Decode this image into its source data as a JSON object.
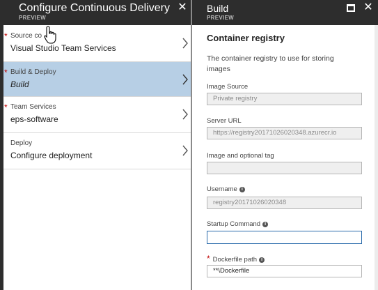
{
  "left_blade": {
    "title": "Configure Continuous Delivery",
    "subtitle": "PREVIEW",
    "close_glyph": "✕",
    "steps": [
      {
        "label": "Source co",
        "value": "Visual Studio Team Services",
        "required": "*"
      },
      {
        "label": "Build & Deploy",
        "value": "Build",
        "required": "*",
        "selected": true
      },
      {
        "label": "Team Services",
        "value": "eps-software",
        "required": "*"
      },
      {
        "label": "Deploy",
        "value": "Configure deployment"
      }
    ]
  },
  "right_blade": {
    "title": "Build",
    "subtitle": "PREVIEW",
    "close_glyph": "✕",
    "section_title": "Container registry",
    "section_desc": "The container registry to use for storing images",
    "fields": [
      {
        "label": "Image Source",
        "value": "Private registry"
      },
      {
        "label": "Server URL",
        "value": "https://registry20171026020348.azurecr.io"
      },
      {
        "label": "Image and optional tag",
        "value": ""
      },
      {
        "label": "Username",
        "value": "registry20171026020348"
      },
      {
        "label": "Startup Command",
        "value": ""
      },
      {
        "label": "Dockerfile path",
        "value": "**\\Dockerfile",
        "required": "*"
      }
    ],
    "info_glyph": "i"
  },
  "icons": {
    "chevron": "chevron-right-icon",
    "cursor": "hand-cursor-icon",
    "maximize": "maximize-icon",
    "close": "close-icon",
    "info": "info-icon"
  },
  "colors": {
    "header_bg": "#2d2d2d",
    "selected_bg": "#b7cfe5",
    "required": "#c00000",
    "focus_border": "#2a6bab"
  }
}
